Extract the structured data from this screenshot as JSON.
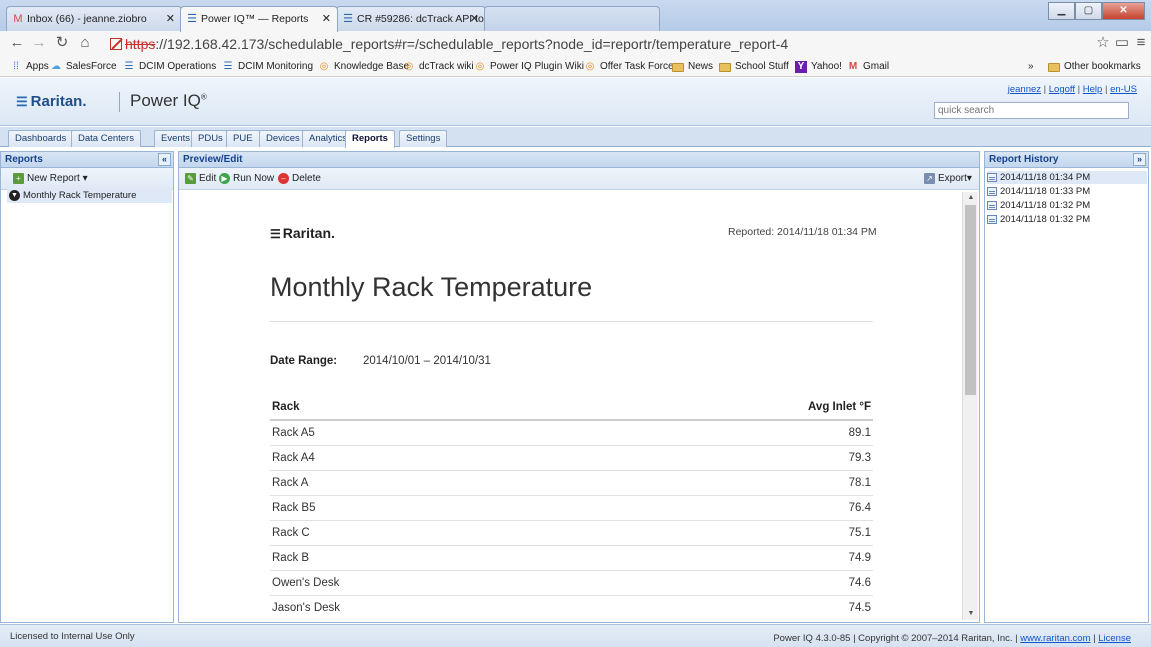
{
  "browser": {
    "tabs": [
      {
        "label": "Inbox (66) - jeanne.ziobro",
        "icon": "M"
      },
      {
        "label": "Power IQ™ — Reports",
        "icon": "☰"
      },
      {
        "label": "CR #59286: dcTrack API to",
        "icon": "☰"
      }
    ],
    "url_scheme": "https",
    "url_rest": "://192.168.42.173/schedulable_reports#r=/schedulable_reports?node_id=reportr/temperature_report-4",
    "bookmarks": [
      "Apps",
      "SalesForce",
      "DCIM Operations",
      "DCIM Monitoring",
      "Knowledge Base",
      "dcTrack wiki",
      "Power IQ Plugin Wiki",
      "Offer Task Force",
      "News",
      "School Stuff",
      "Yahoo!",
      "Gmail"
    ],
    "other_bookmarks": "Other bookmarks",
    "overflow": "»"
  },
  "header": {
    "brand": "Raritan.",
    "product": "Power IQ",
    "user": "jeannez",
    "logoff": "Logoff",
    "help": "Help",
    "locale": "en-US",
    "search_placeholder": "quick search"
  },
  "nav": {
    "tabs": [
      "Dashboards",
      "Data Centers",
      "Events",
      "PDUs",
      "PUE",
      "Devices",
      "Analytics",
      "Reports",
      "Settings"
    ],
    "active": "Reports"
  },
  "left_panel": {
    "title": "Reports",
    "new_report": "New Report",
    "items": [
      "Monthly Rack Temperature"
    ]
  },
  "center_panel": {
    "title": "Preview/Edit",
    "edit": "Edit",
    "run_now": "Run Now",
    "delete": "Delete",
    "export": "Export"
  },
  "report": {
    "brand": "Raritan.",
    "reported": "Reported: 2014/11/18 01:34 PM",
    "title": "Monthly Rack Temperature",
    "date_range_label": "Date Range:",
    "date_range_value": "2014/10/01 – 2014/10/31",
    "columns": [
      "Rack",
      "Avg Inlet °F"
    ],
    "rows": [
      [
        "Rack A5",
        "89.1"
      ],
      [
        "Rack A4",
        "79.3"
      ],
      [
        "Rack A",
        "78.1"
      ],
      [
        "Rack B5",
        "76.4"
      ],
      [
        "Rack C",
        "75.1"
      ],
      [
        "Rack B",
        "74.9"
      ],
      [
        "Owen's Desk",
        "74.6"
      ],
      [
        "Jason's Desk",
        "74.5"
      ]
    ]
  },
  "right_panel": {
    "title": "Report History",
    "items": [
      "2014/11/18 01:34 PM",
      "2014/11/18 01:33 PM",
      "2014/11/18 01:32 PM",
      "2014/11/18 01:32 PM"
    ]
  },
  "footer": {
    "license": "Licensed to Internal Use Only",
    "version": "Power IQ 4.3.0-85 | Copyright © 2007–2014 Raritan, Inc. |",
    "site": "www.raritan.com",
    "license_link": "License"
  }
}
